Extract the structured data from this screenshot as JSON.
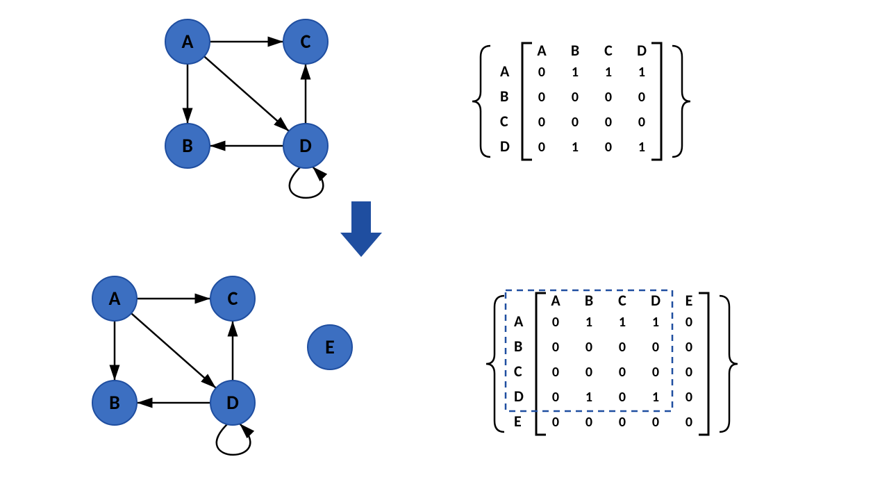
{
  "colors": {
    "node_fill": "#3c6fc1",
    "node_stroke": "#1f4ea0",
    "arrow": "#1f4ea0",
    "dashed": "#1f4ea0"
  },
  "graph_top": {
    "nodes": [
      {
        "id": "A",
        "label": "A"
      },
      {
        "id": "B",
        "label": "B"
      },
      {
        "id": "C",
        "label": "C"
      },
      {
        "id": "D",
        "label": "D"
      }
    ],
    "edges": [
      [
        "A",
        "B"
      ],
      [
        "A",
        "C"
      ],
      [
        "A",
        "D"
      ],
      [
        "D",
        "B"
      ],
      [
        "D",
        "C"
      ],
      [
        "D",
        "D"
      ]
    ]
  },
  "graph_bottom": {
    "nodes": [
      {
        "id": "A",
        "label": "A"
      },
      {
        "id": "B",
        "label": "B"
      },
      {
        "id": "C",
        "label": "C"
      },
      {
        "id": "D",
        "label": "D"
      },
      {
        "id": "E",
        "label": "E"
      }
    ],
    "edges": [
      [
        "A",
        "B"
      ],
      [
        "A",
        "C"
      ],
      [
        "A",
        "D"
      ],
      [
        "D",
        "B"
      ],
      [
        "D",
        "C"
      ],
      [
        "D",
        "D"
      ]
    ]
  },
  "matrix_top": {
    "cols": [
      "A",
      "B",
      "C",
      "D"
    ],
    "rows": [
      "A",
      "B",
      "C",
      "D"
    ],
    "data": [
      [
        0,
        1,
        1,
        1
      ],
      [
        0,
        0,
        0,
        0
      ],
      [
        0,
        0,
        0,
        0
      ],
      [
        0,
        1,
        0,
        1
      ]
    ]
  },
  "matrix_bottom": {
    "cols": [
      "A",
      "B",
      "C",
      "D",
      "E"
    ],
    "rows": [
      "A",
      "B",
      "C",
      "D",
      "E"
    ],
    "data": [
      [
        0,
        1,
        1,
        1,
        0
      ],
      [
        0,
        0,
        0,
        0,
        0
      ],
      [
        0,
        0,
        0,
        0,
        0
      ],
      [
        0,
        1,
        0,
        1,
        0
      ],
      [
        0,
        0,
        0,
        0,
        0
      ]
    ]
  }
}
